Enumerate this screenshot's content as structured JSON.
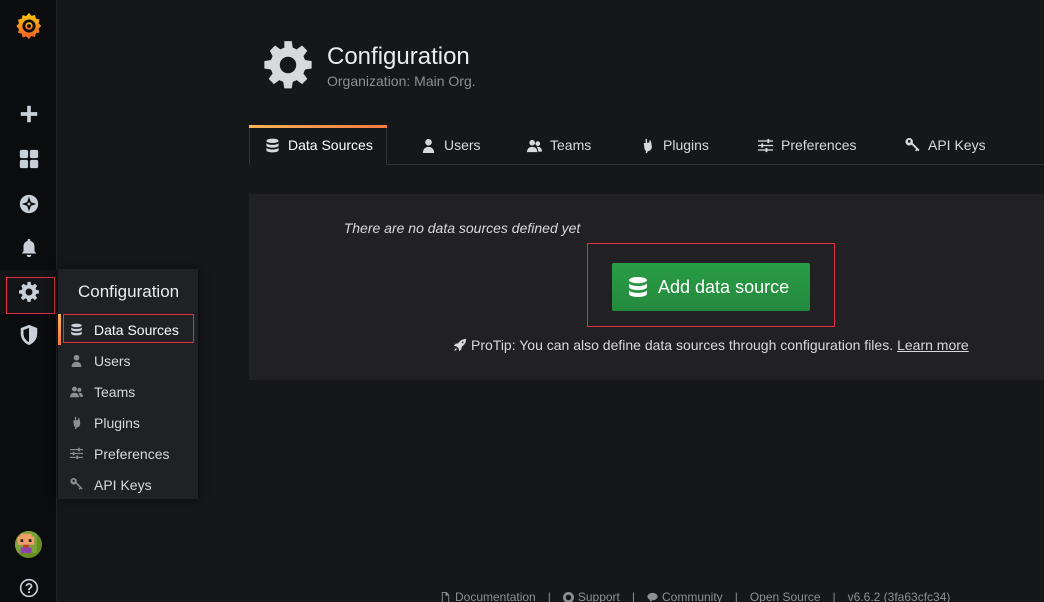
{
  "sidemenu": {
    "logo_icon": "grafana-logo-icon",
    "items": [
      {
        "icon": "plus-icon"
      },
      {
        "icon": "dashboards-grid-icon"
      },
      {
        "icon": "compass-icon"
      },
      {
        "icon": "bell-icon"
      },
      {
        "icon": "gear-icon"
      },
      {
        "icon": "shield-icon"
      }
    ],
    "avatar_icon": "user-avatar",
    "help_icon": "question-icon"
  },
  "flyout": {
    "title": "Configuration",
    "items": [
      {
        "label": "Data Sources",
        "icon": "database-icon",
        "active": true
      },
      {
        "label": "Users",
        "icon": "user-icon"
      },
      {
        "label": "Teams",
        "icon": "users-icon"
      },
      {
        "label": "Plugins",
        "icon": "plug-icon"
      },
      {
        "label": "Preferences",
        "icon": "sliders-icon"
      },
      {
        "label": "API Keys",
        "icon": "key-icon"
      }
    ]
  },
  "header": {
    "title": "Configuration",
    "subtitle": "Organization: Main Org."
  },
  "tabs": [
    {
      "label": "Data Sources",
      "icon": "database-icon",
      "active": true
    },
    {
      "label": "Users",
      "icon": "user-icon"
    },
    {
      "label": "Teams",
      "icon": "users-icon"
    },
    {
      "label": "Plugins",
      "icon": "plug-icon"
    },
    {
      "label": "Preferences",
      "icon": "sliders-icon"
    },
    {
      "label": "API Keys",
      "icon": "key-icon"
    }
  ],
  "empty_state": {
    "message": "There are no data sources defined yet",
    "button_label": "Add data source",
    "protip_text": "ProTip: You can also define data sources through configuration files.",
    "protip_link": "Learn more"
  },
  "footer": {
    "documentation": "Documentation",
    "support": "Support",
    "community": "Community",
    "open_source": "Open Source",
    "version": "v6.6.2 (3fa63cfc34)"
  },
  "colors": {
    "accent_orange": "#ff7941",
    "button_green": "#299c46",
    "highlight_red": "#e02f44"
  }
}
